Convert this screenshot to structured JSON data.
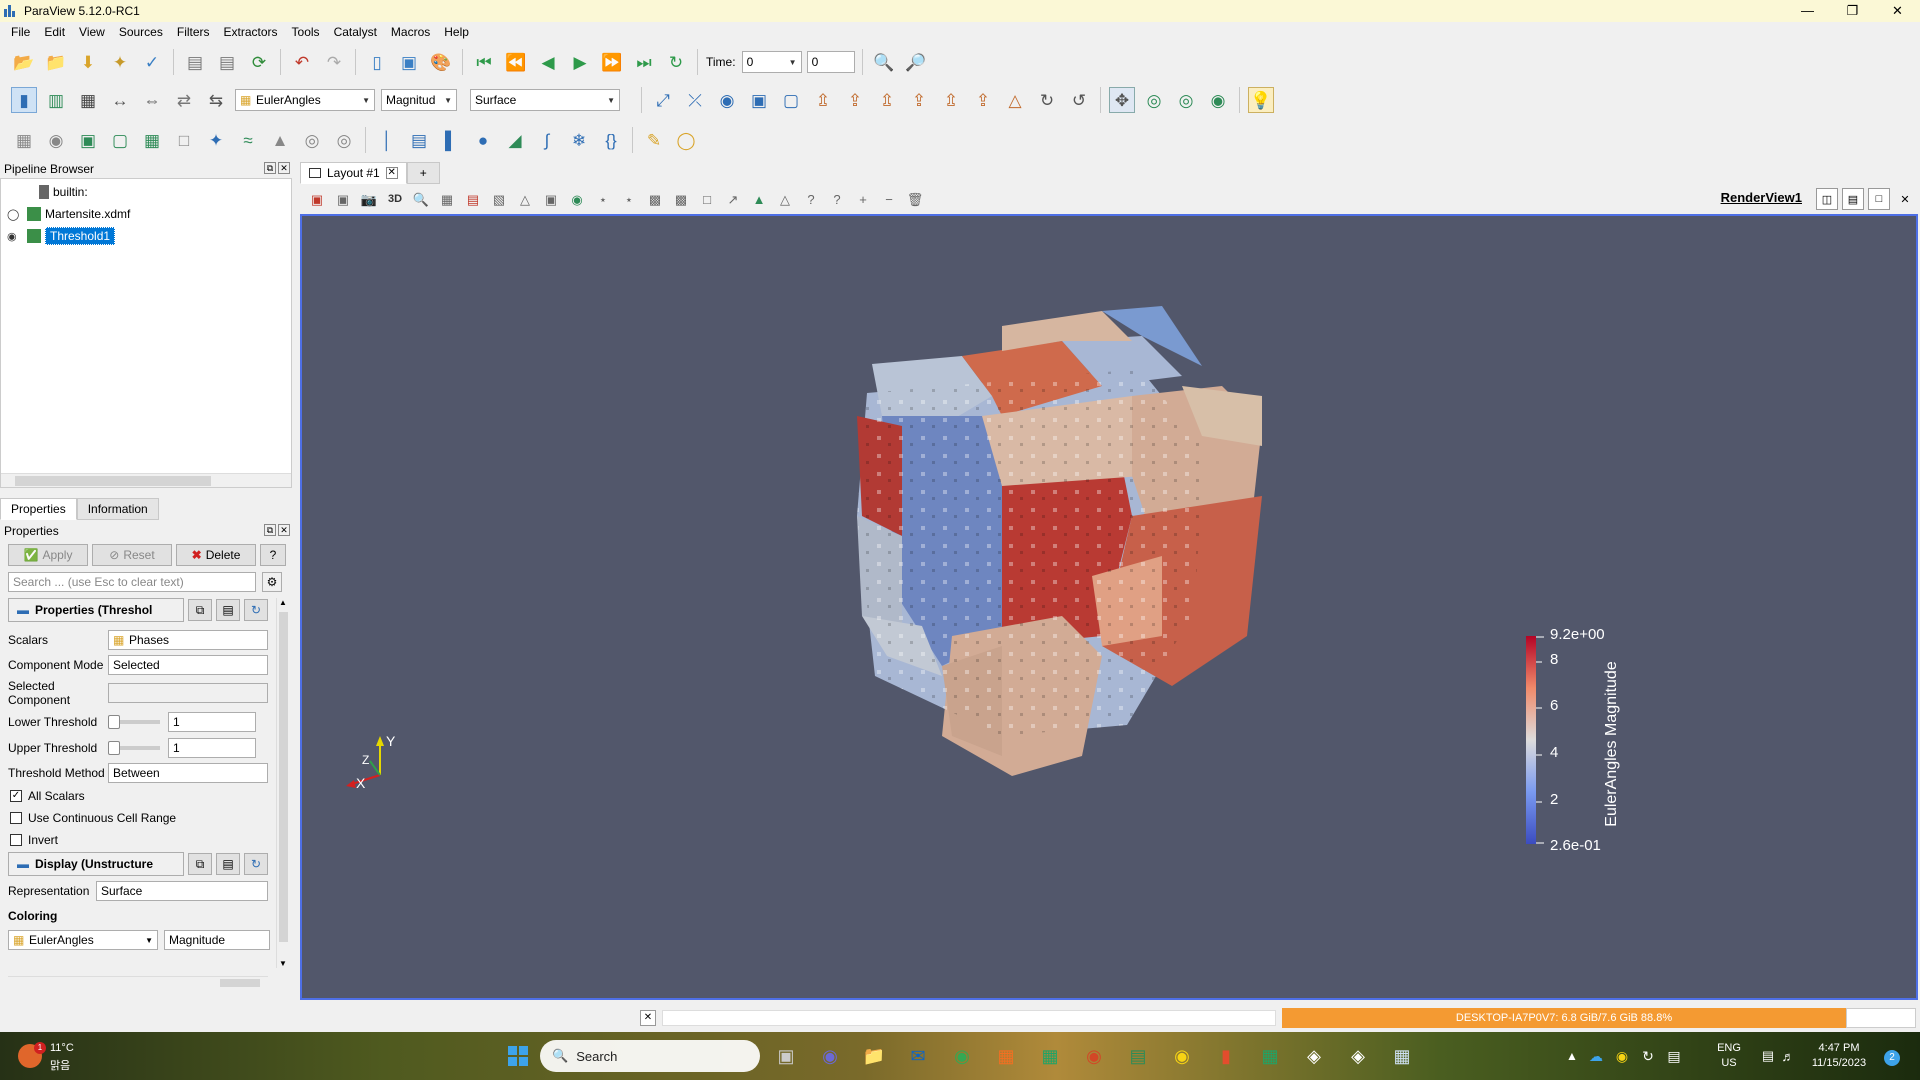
{
  "window": {
    "title": "ParaView 5.12.0-RC1",
    "controls": [
      "—",
      "❐",
      "✕"
    ]
  },
  "menu": [
    "File",
    "Edit",
    "View",
    "Sources",
    "Filters",
    "Extractors",
    "Tools",
    "Catalyst",
    "Macros",
    "Help"
  ],
  "toolbar": {
    "time_label": "Time:",
    "time_value": "0",
    "time_index": "0",
    "array_combo": "EulerAngles",
    "component_combo": "Magnitud",
    "representation_combo": "Surface"
  },
  "pipeline": {
    "title": "Pipeline Browser",
    "items": [
      "builtin:",
      "Martensite.xdmf",
      "Threshold1"
    ]
  },
  "panel_tabs": [
    "Properties",
    "Information"
  ],
  "properties": {
    "title": "Properties",
    "apply": "Apply",
    "reset": "Reset",
    "delete": "Delete",
    "help": "?",
    "search_placeholder": "Search ... (use Esc to clear text)",
    "section_threshold": "Properties (Threshol",
    "scalars_label": "Scalars",
    "scalars_value": "Phases",
    "component_mode_label": "Component Mode",
    "component_mode_value": "Selected",
    "selected_component_label_1": "Selected",
    "selected_component_label_2": "Component",
    "lower_label": "Lower Threshold",
    "lower_value": "1",
    "upper_label": "Upper Threshold",
    "upper_value": "1",
    "method_label": "Threshold Method",
    "method_value": "Between",
    "all_scalars": "All Scalars",
    "continuous": "Use Continuous Cell Range",
    "invert": "Invert",
    "section_display": "Display (Unstructure",
    "representation_label": "Representation",
    "representation_value": "Surface",
    "coloring_label": "Coloring",
    "coloring_array": "EulerAngles",
    "coloring_component": "Magnitude"
  },
  "layout": {
    "tab": "Layout #1",
    "add": "+",
    "view_name": "RenderView1",
    "view_3d": "3D"
  },
  "scalar_bar": {
    "title": "EulerAngles Magnitude",
    "max": "9.2e+00",
    "ticks": [
      "8",
      "6",
      "4",
      "2"
    ],
    "min": "2.6e-01"
  },
  "axes": {
    "x": "X",
    "y": "Y",
    "z": "Z"
  },
  "status": {
    "memory": "DESKTOP-IA7P0V7: 6.8 GiB/7.6 GiB 88.8%"
  },
  "taskbar": {
    "weather_temp": "11°C",
    "weather_desc": "맑음",
    "search": "Search",
    "lang1": "ENG",
    "lang2": "US",
    "time": "4:47 PM",
    "date": "11/15/2023",
    "notif_count": "2"
  },
  "colors": {
    "render_bg": "#52576b",
    "accent": "#0078d7",
    "memory": "#f49a32"
  }
}
